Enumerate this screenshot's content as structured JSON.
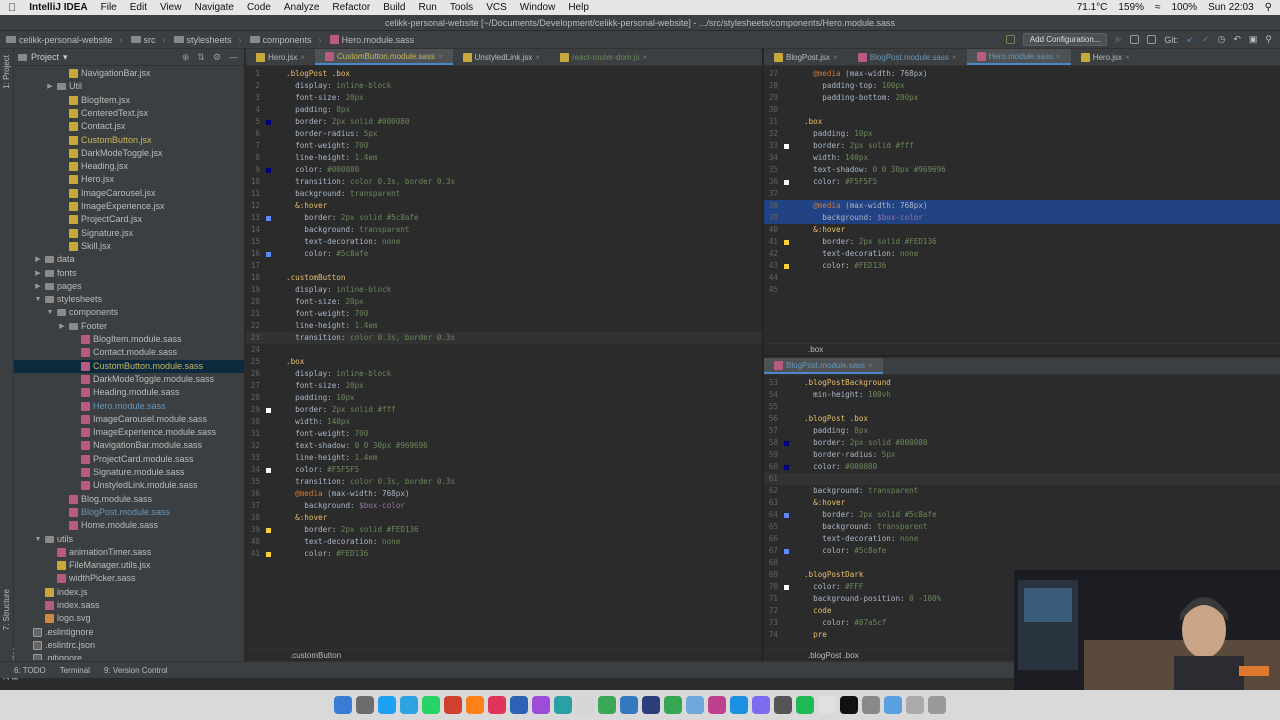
{
  "menubar": {
    "app": "IntelliJ IDEA",
    "items": [
      "File",
      "Edit",
      "View",
      "Navigate",
      "Code",
      "Analyze",
      "Refactor",
      "Build",
      "Run",
      "Tools",
      "VCS",
      "Window",
      "Help"
    ],
    "battery": "100%",
    "clock": "Sun 22:03",
    "temp": "71.1°C",
    "cpu": "159%"
  },
  "titlebar": {
    "path": "celikk-personal-website [~/Documents/Development/celikk-personal-website] - .../src/stylesheets/components/Hero.module.sass"
  },
  "breadcrumb": {
    "items": [
      "celikk-personal-website",
      "src",
      "stylesheets",
      "components",
      "Hero.module.sass"
    ],
    "add_config": "Add Configuration...",
    "git_label": "Git:"
  },
  "project_panel": {
    "title": "Project",
    "rows": [
      {
        "label": "NavigationBar.jsx",
        "type": "js",
        "depth": 4,
        "color": ""
      },
      {
        "label": "Util",
        "type": "dir",
        "depth": 3,
        "arrow": "▶",
        "color": ""
      },
      {
        "label": "BlogItem.jsx",
        "type": "js",
        "depth": 4,
        "color": ""
      },
      {
        "label": "CenteredText.jsx",
        "type": "js",
        "depth": 4,
        "color": ""
      },
      {
        "label": "Contact.jsx",
        "type": "js",
        "depth": 4,
        "color": ""
      },
      {
        "label": "CustomButton.jsx",
        "type": "js",
        "depth": 4,
        "color": "yellow"
      },
      {
        "label": "DarkModeToggle.jsx",
        "type": "js",
        "depth": 4,
        "color": ""
      },
      {
        "label": "Heading.jsx",
        "type": "js",
        "depth": 4,
        "color": ""
      },
      {
        "label": "Hero.jsx",
        "type": "js",
        "depth": 4,
        "color": ""
      },
      {
        "label": "ImageCarousel.jsx",
        "type": "js",
        "depth": 4,
        "color": ""
      },
      {
        "label": "ImageExperience.jsx",
        "type": "js",
        "depth": 4,
        "color": ""
      },
      {
        "label": "ProjectCard.jsx",
        "type": "js",
        "depth": 4,
        "color": ""
      },
      {
        "label": "Signature.jsx",
        "type": "js",
        "depth": 4,
        "color": ""
      },
      {
        "label": "Skill.jsx",
        "type": "js",
        "depth": 4,
        "color": ""
      },
      {
        "label": "data",
        "type": "dir",
        "depth": 2,
        "arrow": "▶",
        "color": ""
      },
      {
        "label": "fonts",
        "type": "dir",
        "depth": 2,
        "arrow": "▶",
        "color": ""
      },
      {
        "label": "pages",
        "type": "dir",
        "depth": 2,
        "arrow": "▶",
        "color": ""
      },
      {
        "label": "stylesheets",
        "type": "dir",
        "depth": 2,
        "arrow": "▼",
        "color": ""
      },
      {
        "label": "components",
        "type": "dir",
        "depth": 3,
        "arrow": "▼",
        "color": ""
      },
      {
        "label": "Footer",
        "type": "dir",
        "depth": 4,
        "arrow": "▶",
        "color": ""
      },
      {
        "label": "BlogItem.module.sass",
        "type": "sass",
        "depth": 5,
        "color": ""
      },
      {
        "label": "Contact.module.sass",
        "type": "sass",
        "depth": 5,
        "color": ""
      },
      {
        "label": "CustomButton.module.sass",
        "type": "sass",
        "depth": 5,
        "color": "yellow",
        "selected": true
      },
      {
        "label": "DarkModeToggle.module.sass",
        "type": "sass",
        "depth": 5,
        "color": ""
      },
      {
        "label": "Heading.module.sass",
        "type": "sass",
        "depth": 5,
        "color": ""
      },
      {
        "label": "Hero.module.sass",
        "type": "sass",
        "depth": 5,
        "color": "blue"
      },
      {
        "label": "ImageCarousel.module.sass",
        "type": "sass",
        "depth": 5,
        "color": ""
      },
      {
        "label": "ImageExperience.module.sass",
        "type": "sass",
        "depth": 5,
        "color": ""
      },
      {
        "label": "NavigationBar.module.sass",
        "type": "sass",
        "depth": 5,
        "color": ""
      },
      {
        "label": "ProjectCard.module.sass",
        "type": "sass",
        "depth": 5,
        "color": ""
      },
      {
        "label": "Signature.module.sass",
        "type": "sass",
        "depth": 5,
        "color": ""
      },
      {
        "label": "UnstyledLink.module.sass",
        "type": "sass",
        "depth": 5,
        "color": ""
      },
      {
        "label": "Blog.module.sass",
        "type": "sass",
        "depth": 4,
        "color": ""
      },
      {
        "label": "BlogPost.module.sass",
        "type": "sass",
        "depth": 4,
        "color": "blue"
      },
      {
        "label": "Home.module.sass",
        "type": "sass",
        "depth": 4,
        "color": ""
      },
      {
        "label": "utils",
        "type": "dir",
        "depth": 2,
        "arrow": "▼",
        "color": ""
      },
      {
        "label": "animationTimer.sass",
        "type": "sass",
        "depth": 3,
        "color": ""
      },
      {
        "label": "FileManager.utils.jsx",
        "type": "js",
        "depth": 3,
        "color": ""
      },
      {
        "label": "widthPicker.sass",
        "type": "sass",
        "depth": 3,
        "color": ""
      },
      {
        "label": "index.js",
        "type": "js",
        "depth": 2,
        "color": ""
      },
      {
        "label": "index.sass",
        "type": "sass",
        "depth": 2,
        "color": ""
      },
      {
        "label": "logo.svg",
        "type": "svg",
        "depth": 2,
        "color": ""
      },
      {
        "label": ".eslintignore",
        "type": "cfg",
        "depth": 1,
        "color": ""
      },
      {
        "label": ".eslintrc.json",
        "type": "cfg",
        "depth": 1,
        "color": ""
      },
      {
        "label": ".gitignore",
        "type": "cfg",
        "depth": 1,
        "color": ""
      }
    ]
  },
  "left_editor": {
    "tabs": [
      {
        "label": "Hero.jsx",
        "active": false,
        "color": ""
      },
      {
        "label": "CustomButton.module.sass",
        "active": true,
        "color": "yellow"
      },
      {
        "label": "UnstyledLink.jsx",
        "active": false,
        "color": ""
      },
      {
        "label": "react-router-dom.js",
        "active": false,
        "color": "green"
      }
    ],
    "lines": [
      ".blogPost .box",
      "  display: inline-block",
      "  font-size: 20px",
      "  padding: 8px",
      "  border: 2px solid #000080",
      "  border-radius: 5px",
      "  font-weight: 700",
      "  line-height: 1.4em",
      "  color: #000080",
      "  transition: color 0.3s, border 0.3s",
      "  background: transparent",
      "  &:hover",
      "    border: 2px solid #5c8afe",
      "    background: transparent",
      "    text-decoration: none",
      "    color: #5c8afe",
      "",
      ".customButton",
      "  display: inline-block",
      "  font-size: 20px",
      "  font-weight: 700",
      "  line-height: 1.4em",
      "  transition: color 0.3s, border 0.3s",
      "",
      ".box",
      "  display: inline-block",
      "  font-size: 20px",
      "  padding: 10px",
      "  border: 2px solid #fff",
      "  width: 140px",
      "  font-weight: 700",
      "  text-shadow: 0 0 30px #969696",
      "  line-height: 1.4em",
      "  color: #F5F5F5",
      "  transition: color 0.3s, border 0.3s",
      "  @media (max-width: 768px)",
      "    background: $box-color",
      "  &:hover",
      "    border: 2px solid #FED136",
      "    text-decoration: none",
      "    color: #FED136"
    ],
    "footer": ".customButton"
  },
  "right_top_editor": {
    "tabs": [
      {
        "label": "BlogPost.jsx",
        "active": false,
        "color": ""
      },
      {
        "label": "BlogPost.module.sass",
        "active": false,
        "color": "blue"
      },
      {
        "label": "Hero.module.sass",
        "active": true,
        "color": "blue"
      },
      {
        "label": "Hero.jsx",
        "active": false,
        "color": ""
      }
    ],
    "start": 27,
    "lines": [
      "  @media (max-width: 768px)",
      "    padding-top: 100px",
      "    padding-bottom: 200px",
      "",
      ".box",
      "  padding: 10px",
      "  border: 2px solid #fff",
      "  width: 140px",
      "  text-shadow: 0 0 30px #969696",
      "  color: #F5F5F5",
      "",
      "  @media (max-width: 768px)",
      "    background: $box-color",
      "  &:hover",
      "    border: 2px solid #FED136",
      "    text-decoration: none",
      "    color: #FED136",
      "",
      ""
    ],
    "footer": ".box"
  },
  "right_bottom_editor": {
    "tab": "BlogPost.module.sass",
    "start": 53,
    "lines": [
      ".blogPostBackground",
      "  min-height: 100vh",
      "",
      ".blogPost .box",
      "  padding: 8px",
      "  border: 2px solid #000080",
      "  border-radius: 5px",
      "  color: #000080",
      "",
      "  background: transparent",
      "  &:hover",
      "    border: 2px solid #5c8afe",
      "    background: transparent",
      "    text-decoration: none",
      "    color: #5c8afe",
      "",
      ".blogPostDark",
      "  color: #FFF",
      "  background-position: 0 -100%",
      "  code",
      "    color: #87a5cf",
      "  pre"
    ],
    "footer": ".blogPost .box"
  },
  "statusbar": {
    "items": [
      "6: TODO",
      "Terminal",
      "9: Version Control"
    ]
  },
  "side_labels": [
    "1: Project",
    "7: Structure",
    "2: Favorites"
  ],
  "colors": {
    "accent": "#4a88c7",
    "selection": "#214283",
    "editor_bg": "#2b2b2b",
    "panel_bg": "#3c3f41"
  }
}
